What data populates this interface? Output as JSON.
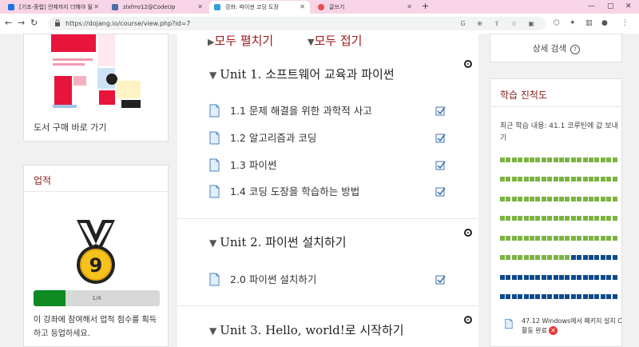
{
  "browser": {
    "tabs": [
      {
        "title": "[기조-종합] 언제까지 더해야 될",
        "color": "#1a73e8"
      },
      {
        "title": "zlxfrro12@CodeUp",
        "color": "#4a6fa5"
      },
      {
        "title": "강좌: 파이썬 코딩 도장",
        "color": "#34a0d8"
      },
      {
        "title": "글쓰기",
        "color": "#e94c4c"
      }
    ],
    "url": "https://dojang.io/course/view.php?id=7"
  },
  "left": {
    "book_buy": "도서 구매 바로 가기",
    "achievement": {
      "title": "업적",
      "badge_number": "9",
      "progress_text": "1/4",
      "progress_fraction": 0.25,
      "description": "이 강좌에 참여해서 업적 점수를 획득하고 등업하세요."
    }
  },
  "center": {
    "expand_all": "모두 펼치기",
    "collapse_all": "모두 접기",
    "units": [
      {
        "title": "Unit 1. 소프트웨어 교육과 파이썬",
        "lessons": [
          "1.1 문제 해결을 위한 과학적 사고",
          "1.2 알고리즘과 코딩",
          "1.3 파이썬",
          "1.4 코딩 도장을 학습하는 방법"
        ]
      },
      {
        "title": "Unit 2. 파이썬 설치하기",
        "lessons": [
          "2.0 파이썬 설치하기"
        ]
      },
      {
        "title": "Unit 3. Hello, world!로 시작하기",
        "lessons": []
      }
    ]
  },
  "right": {
    "detail_search": "상세 검색",
    "progress": {
      "title": "학습 진척도",
      "recent_label": "최근 학습 내용: 41.1 코루틴에 값 보내기",
      "completed_cells": 112,
      "total_cells": 160,
      "colors": {
        "done": "#7cb342",
        "todo": "#0d4a8a"
      },
      "recent_item": "47.12 Windows에서 패키지 설치 C",
      "recent_status": "활동 완료"
    }
  }
}
